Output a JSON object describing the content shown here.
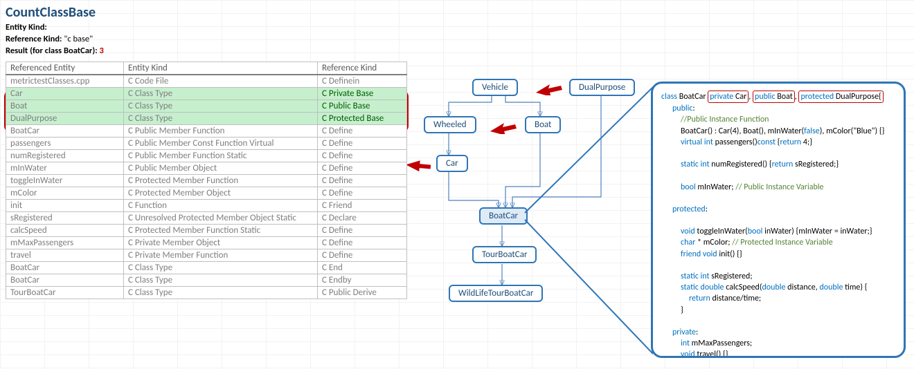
{
  "title": "CountClassBase",
  "meta": {
    "entity_kind_label": "Entity Kind:",
    "reference_kind_label": "Reference Kind:",
    "reference_kind_value": "\"c base\"",
    "result_label": "Result  (for class BoatCar):",
    "result_value": "3"
  },
  "table": {
    "headers": [
      "Referenced Entity",
      "Entity Kind",
      "Reference Kind"
    ],
    "rows": [
      {
        "entity": "metrictestClasses.cpp",
        "kind": "C Code File",
        "ref": "C Definein",
        "hl": false
      },
      {
        "entity": "Car",
        "kind": "C Class Type",
        "ref": "C Private Base",
        "hl": true
      },
      {
        "entity": "Boat",
        "kind": "C Class Type",
        "ref": "C Public Base",
        "hl": true
      },
      {
        "entity": "DualPurpose",
        "kind": "C Class Type",
        "ref": "C Protected Base",
        "hl": true
      },
      {
        "entity": "BoatCar",
        "kind": "C Public Member Function",
        "ref": "C Define",
        "hl": false
      },
      {
        "entity": "passengers",
        "kind": "C Public Member Const Function Virtual",
        "ref": "C Define",
        "hl": false
      },
      {
        "entity": "numRegistered",
        "kind": "C Public Member Function Static",
        "ref": "C Define",
        "hl": false
      },
      {
        "entity": "mInWater",
        "kind": "C Public Member Object",
        "ref": "C Define",
        "hl": false
      },
      {
        "entity": "toggleInWater",
        "kind": "C Protected Member Function",
        "ref": "C Define",
        "hl": false
      },
      {
        "entity": "mColor",
        "kind": "C Protected Member Object",
        "ref": "C Define",
        "hl": false
      },
      {
        "entity": "init",
        "kind": "C Function",
        "ref": "C Friend",
        "hl": false
      },
      {
        "entity": "sRegistered",
        "kind": "C Unresolved Protected Member Object Static",
        "ref": "C Declare",
        "hl": false
      },
      {
        "entity": "calcSpeed",
        "kind": "C Protected Member Function Static",
        "ref": "C Define",
        "hl": false
      },
      {
        "entity": "mMaxPassengers",
        "kind": "C Private Member Object",
        "ref": "C Define",
        "hl": false
      },
      {
        "entity": "travel",
        "kind": "C Private Member Function",
        "ref": "C Define",
        "hl": false
      },
      {
        "entity": "BoatCar",
        "kind": "C Class Type",
        "ref": "C End",
        "hl": false
      },
      {
        "entity": "BoatCar",
        "kind": "C Class Type",
        "ref": "C Endby",
        "hl": false
      },
      {
        "entity": "TourBoatCar",
        "kind": "C Class Type",
        "ref": "C Public Derive",
        "hl": false
      }
    ]
  },
  "diagram": {
    "nodes": {
      "vehicle": "Vehicle",
      "dualpurpose": "DualPurpose",
      "wheeled": "Wheeled",
      "boat": "Boat",
      "car": "Car",
      "boatcar": "BoatCar",
      "tourboatcar": "TourBoatCar",
      "wildlife": "WildLifeTourBoatCar"
    }
  },
  "code": {
    "line1_pre": "class",
    "line1_name": "BoatCar",
    "box1_kw": "private",
    "box1_nm": "Car",
    "box2_kw": "public",
    "box2_nm": "Boat",
    "box3_kw": "protected",
    "box3_nm": "DualPurpose{",
    "public_label": "public",
    "cm1": "//Public Instance Function",
    "ctor": "BoatCar() : Car(4), Boat(), mInWater(",
    "false_kw": "false",
    "ctor_tail": "), mColor(\"Blue\") {}",
    "virtual_kw": "virtual",
    "int_kw": "int",
    "passengers_sig": " passengers()",
    "const_kw": "const",
    "ret4": " {",
    "return_kw": "return",
    "ret4_tail": " 4;}",
    "static_kw": "static",
    "numreg": " numRegistered() {",
    "return_kw2": "return",
    "numreg_tail": " sRegistered;}",
    "bool_kw": "bool",
    "minwater": " mInWater; ",
    "cm2": "// Public Instance Variable",
    "protected_label": "protected",
    "void_kw": "void",
    "toggle": " toggleInWater(",
    "bool_kw2": "bool",
    "toggle_mid": " inWater) {mInWater = inWater;}",
    "char_kw": "char",
    "mcolor": " * mColor; ",
    "cm3": "// Protected Instance Variable",
    "friend_kw": "friend",
    "void_kw2": "void",
    "init": " init() {}",
    "sreg": " sRegistered;",
    "double_kw": "double",
    "calc": " calcSpeed(",
    "double_kw2": "double",
    "calc_mid": " distance, ",
    "double_kw3": "double",
    "calc_tail": " time) {",
    "return_kw3": "return",
    "calc_body": " distance/time;",
    "brace_close": "}",
    "private_label": "private",
    "mmax": " mMaxPassengers;",
    "travel": " travel() {}",
    "class_close": "};"
  }
}
